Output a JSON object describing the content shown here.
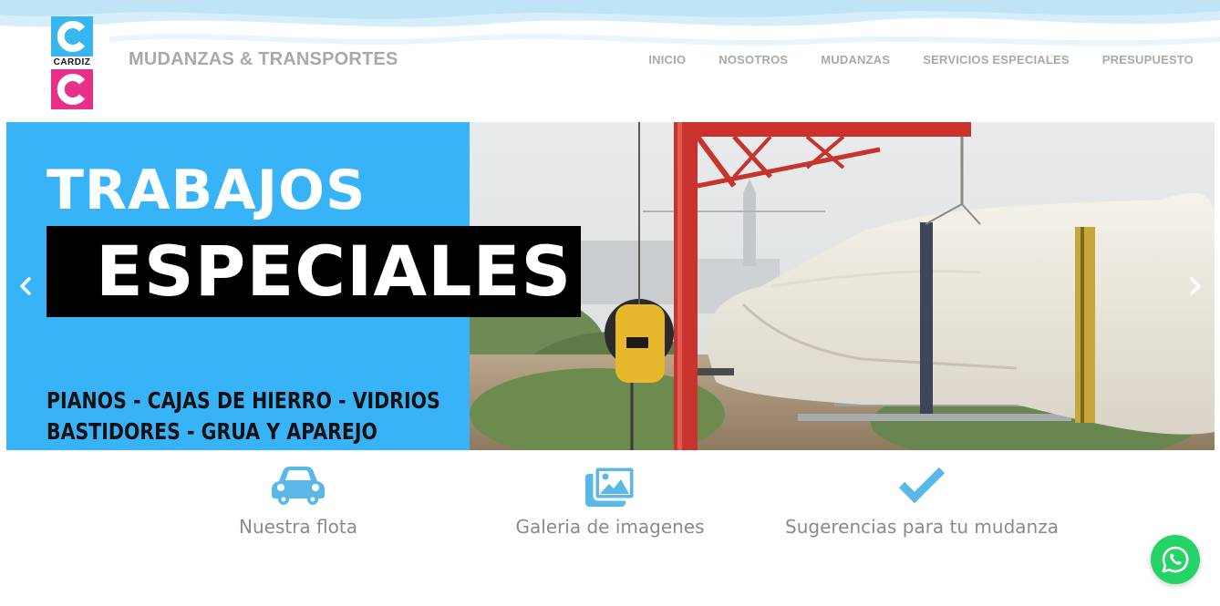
{
  "brand": {
    "logo_text": "CARDIZ",
    "site_title": "MUDANZAS & TRANSPORTES",
    "colors": {
      "blue": "#38b6f0",
      "pink": "#e8308a",
      "gray_text": "#a9a9a9"
    }
  },
  "nav": {
    "items": [
      {
        "label": "INICIO"
      },
      {
        "label": "NOSOTROS"
      },
      {
        "label": "MUDANZAS"
      },
      {
        "label": "SERVICIOS ESPECIALES"
      },
      {
        "label": "PRESUPUESTO"
      }
    ]
  },
  "slider": {
    "title_line1": "TRABAJOS",
    "title_line2": "ESPECIALES",
    "subtitle_line1": "PIANOS - CAJAS DE HIERRO - VIDRIOS",
    "subtitle_line2": "BASTIDORES - GRUA Y APAREJO",
    "prev_icon": "chevron-left-icon",
    "next_icon": "chevron-right-icon",
    "panel_color": "#38b3f7"
  },
  "features": [
    {
      "label": "Nuestra flota",
      "icon": "car-icon"
    },
    {
      "label": "Galeria de imagenes",
      "icon": "images-icon"
    },
    {
      "label": "Sugerencias para tu mudanza",
      "icon": "check-icon"
    }
  ],
  "whatsapp": {
    "icon": "whatsapp-icon",
    "color": "#25d366"
  }
}
